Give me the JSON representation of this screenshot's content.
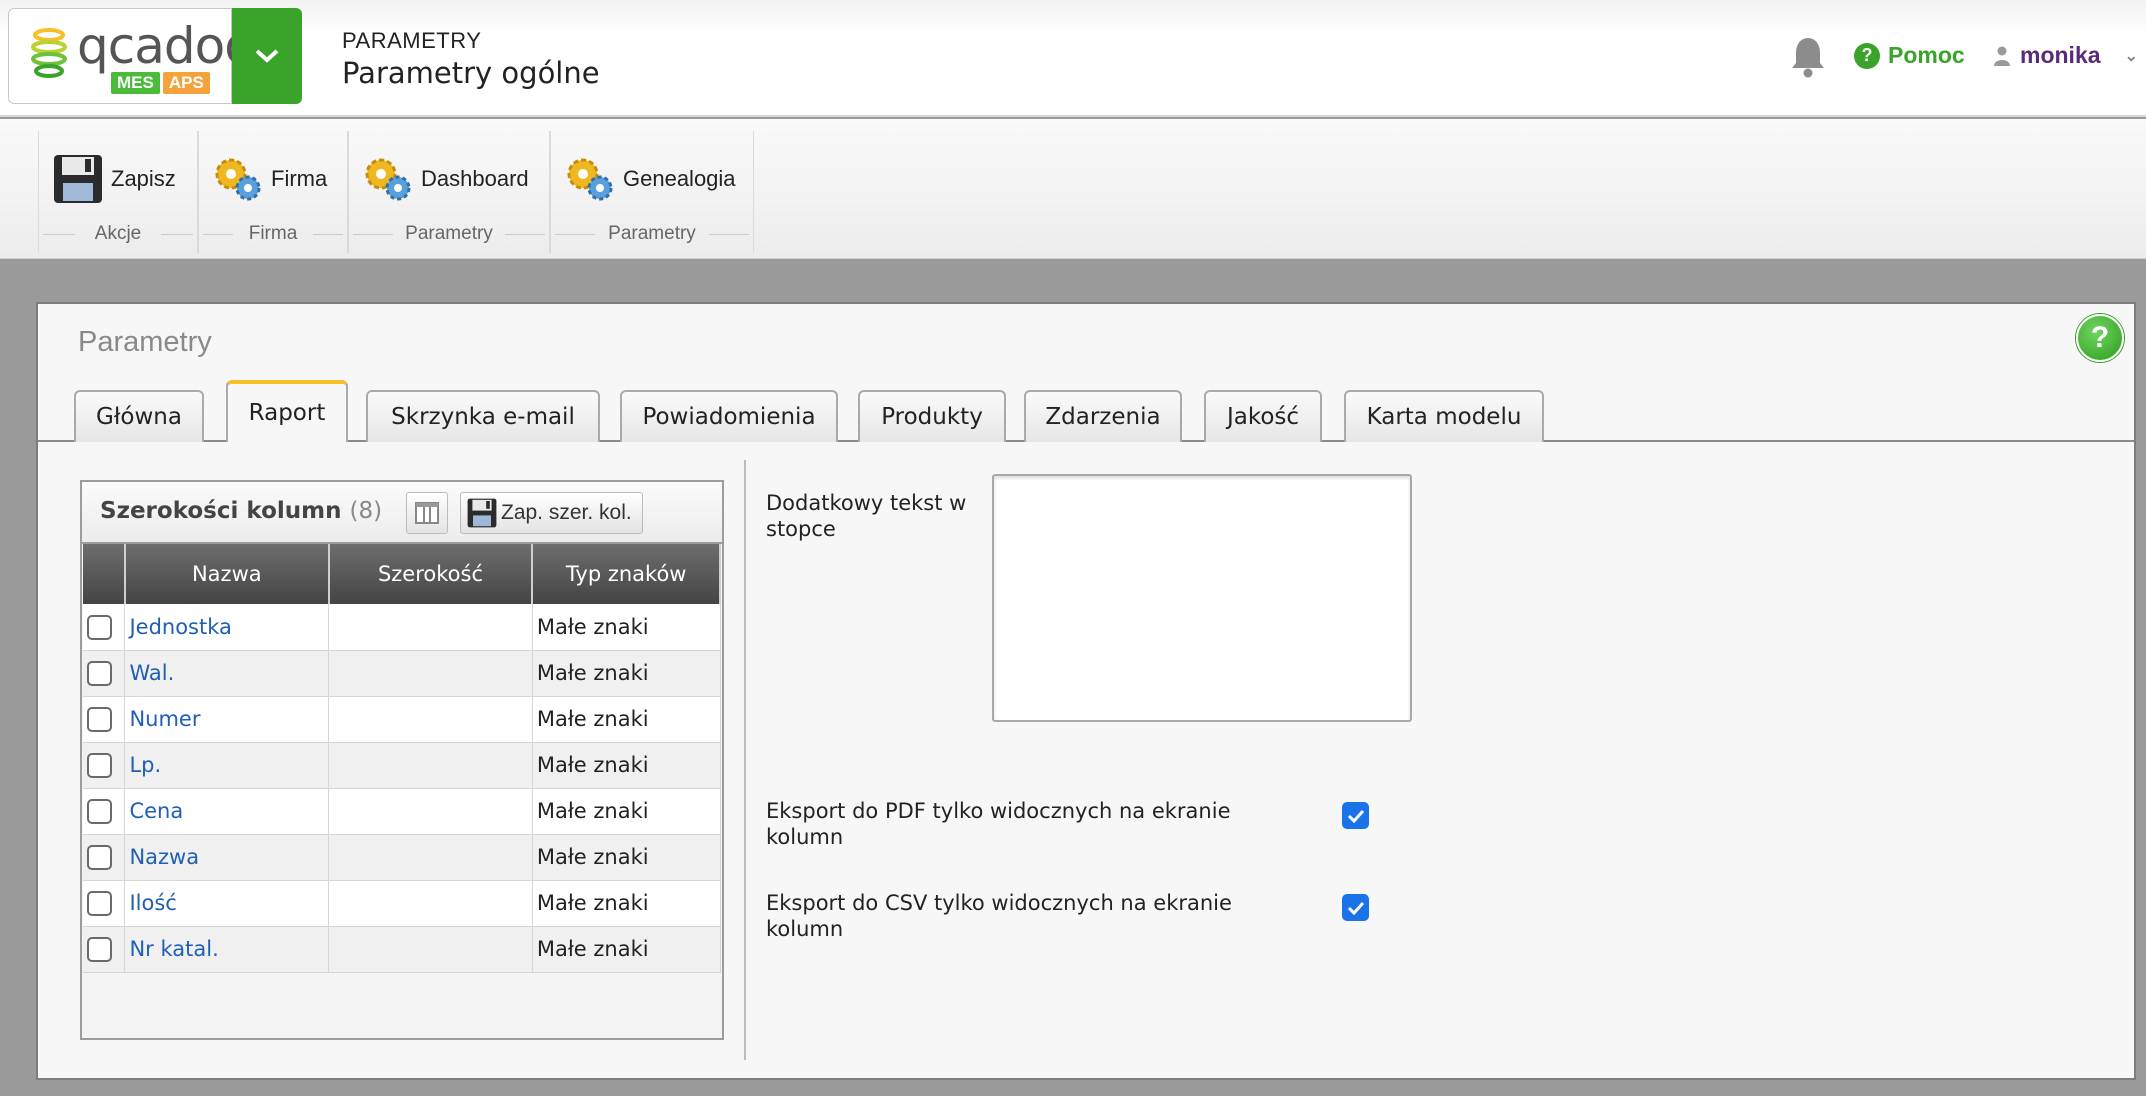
{
  "header": {
    "logo_text": "qcadoo",
    "logo_badge_mes": "MES",
    "logo_badge_aps": "APS",
    "breadcrumb": "PARAMETRY",
    "title": "Parametry ogólne",
    "help_label": "Pomoc",
    "user_name": "monika"
  },
  "ribbon": {
    "groups": [
      {
        "button": "Zapisz",
        "label": "Akcje",
        "icon": "floppy-disk-icon"
      },
      {
        "button": "Firma",
        "label": "Firma",
        "icon": "gears-icon"
      },
      {
        "button": "Dashboard",
        "label": "Parametry",
        "icon": "gears-icon"
      },
      {
        "button": "Genealogia",
        "label": "Parametry",
        "icon": "gears-icon"
      }
    ]
  },
  "panel": {
    "title": "Parametry",
    "help_icon": "?",
    "tabs": [
      "Główna",
      "Raport",
      "Skrzynka e-mail",
      "Powiadomienia",
      "Produkty",
      "Zdarzenia",
      "Jakość",
      "Karta modelu"
    ],
    "active_tab": "Raport"
  },
  "grid": {
    "title": "Szerokości kolumn",
    "count": "(8)",
    "save_widths_label": "Zap. szer. kol.",
    "columns": [
      "Nazwa",
      "Szerokość",
      "Typ znaków"
    ],
    "rows": [
      {
        "name": "Jednostka",
        "width": "",
        "type": "Małe znaki"
      },
      {
        "name": "Wal.",
        "width": "",
        "type": "Małe znaki"
      },
      {
        "name": "Numer",
        "width": "",
        "type": "Małe znaki"
      },
      {
        "name": "Lp.",
        "width": "",
        "type": "Małe znaki"
      },
      {
        "name": "Cena",
        "width": "",
        "type": "Małe znaki"
      },
      {
        "name": "Nazwa",
        "width": "",
        "type": "Małe znaki"
      },
      {
        "name": "Ilość",
        "width": "",
        "type": "Małe znaki"
      },
      {
        "name": "Nr katal.",
        "width": "",
        "type": "Małe znaki"
      }
    ]
  },
  "form": {
    "footer_text_label": "Dodatkowy tekst w stopce",
    "footer_text_value": "",
    "pdf_export_label": "Eksport do PDF tylko widocznych na ekranie kolumn",
    "pdf_export_checked": true,
    "csv_export_label": "Eksport do CSV tylko widocznych na ekranie kolumn",
    "csv_export_checked": true
  },
  "colors": {
    "accent_green": "#3aa329",
    "link_blue": "#1f5fb4",
    "tab_highlight": "#f6c026",
    "checkbox_blue": "#1a73e8"
  }
}
